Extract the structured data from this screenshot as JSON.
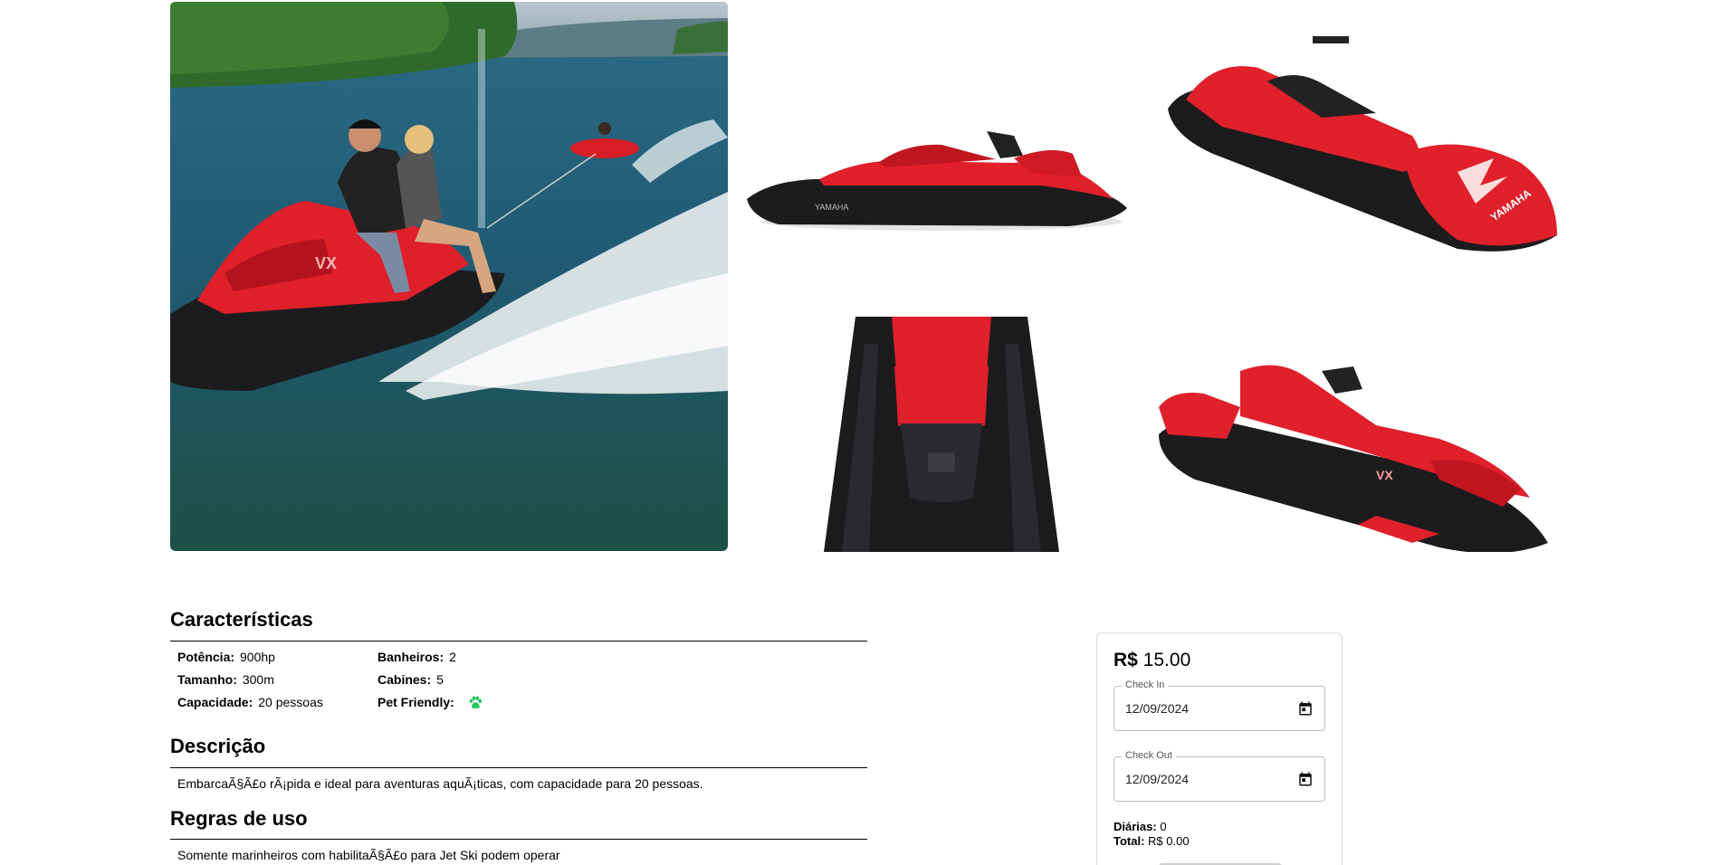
{
  "caracteristicas": {
    "title": "Características",
    "specs": [
      {
        "label": "Potência:",
        "value": "900hp"
      },
      {
        "label": "Tamanho:",
        "value": "300m"
      },
      {
        "label": "Capacidade:",
        "value": "20 pessoas"
      },
      {
        "label": "Banheiros:",
        "value": "2"
      },
      {
        "label": "Cabines:",
        "value": "5"
      },
      {
        "label": "Pet Friendly:",
        "value": ""
      }
    ],
    "pet_icon": "paw-icon",
    "pet_icon_color": "#22c55e"
  },
  "descricao": {
    "title": "Descrição",
    "text": "EmbarcaÃ§Ã£o rÃ¡pida e ideal para aventuras aquÃ¡ticas, com capacidade para 20 pessoas."
  },
  "regras": {
    "title": "Regras de uso",
    "text": "Somente marinheiros com habilitaÃ§Ã£o para Jet Ski podem operar"
  },
  "booking": {
    "currency": "R$",
    "price": "15.00",
    "check_in_label": "Check In",
    "check_in_value": "12/09/2024",
    "check_out_label": "Check Out",
    "check_out_value": "12/09/2024",
    "diarias_label": "Diárias:",
    "diarias_value": "0",
    "total_label": "Total:",
    "total_value": "R$ 0.00",
    "calendar_icon": "calendar-icon"
  },
  "colors": {
    "jetski_red": "#e0202a",
    "jetski_black": "#1c1c1f",
    "water": "#1f5f7a"
  }
}
